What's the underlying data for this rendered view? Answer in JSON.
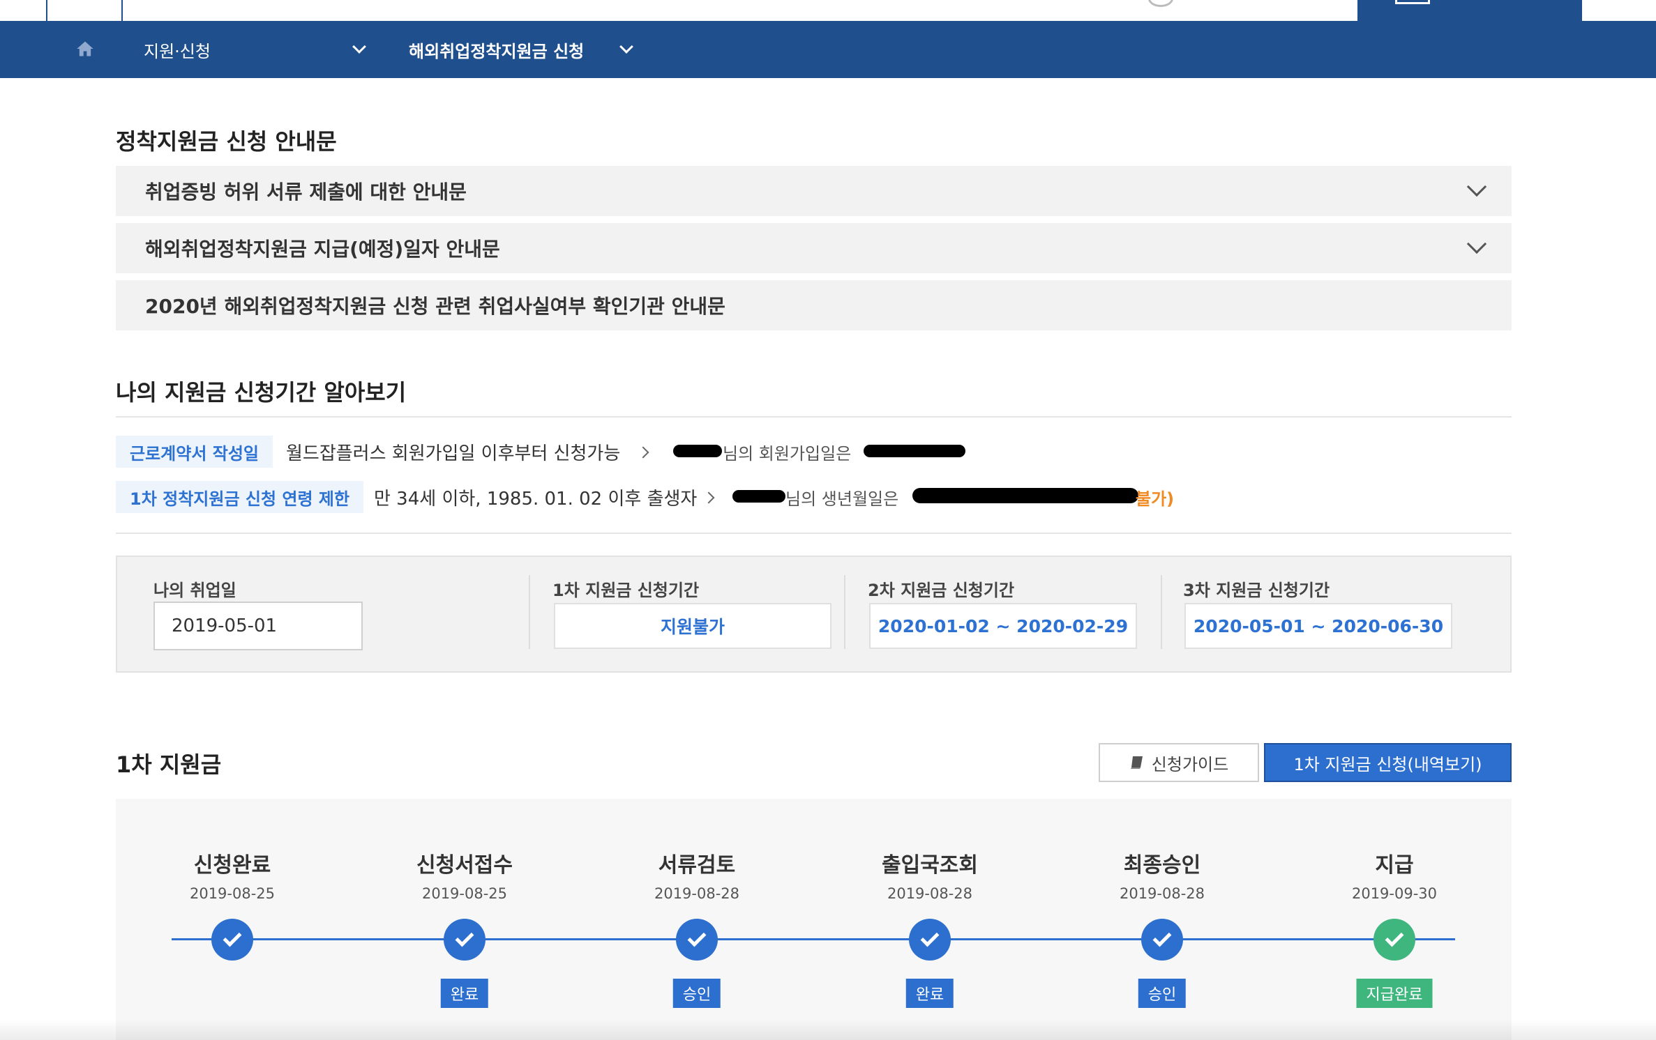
{
  "nav": {
    "item1": "지원·신청",
    "item2": "해외취업정착지원금 신청"
  },
  "notice": {
    "title": "정착지원금 신청 안내문",
    "items": [
      "취업증빙 허위 서류 제출에 대한 안내문",
      "해외취업정착지원금 지급(예정)일자 안내문",
      "2020년 해외취업정착지원금 신청 관련 취업사실여부 확인기관 안내문"
    ]
  },
  "period": {
    "title": "나의 지원금 신청기간 알아보기",
    "row1_tag": "근로계약서 작성일",
    "row1_text": "월드잡플러스 회원가입일 이후부터 신청가능",
    "row1_info": "님의 회원가입일은",
    "row2_tag": "1차 정착지원금 신청 연령 제한",
    "row2_text": "만 34세 이하, 1985. 01. 02 이후 출생자",
    "row2_info": "님의 생년월일은",
    "row2_tail": "불가)"
  },
  "info": {
    "label_my": "나의 취업일",
    "my_value": "2019-05-01",
    "label_1": "1차 지원금 신청기간",
    "value_1": "지원불가",
    "label_2": "2차 지원금 신청기간",
    "value_2": "2020-01-02 ~ 2020-02-29",
    "label_3": "3차 지원금 신청기간",
    "value_3": "2020-05-01 ~ 2020-06-30"
  },
  "first": {
    "title": "1차 지원금",
    "guide_button": "신청가이드",
    "history_button": "1차 지원금 신청(내역보기)"
  },
  "steps": [
    {
      "title": "신청완료",
      "date": "2019-08-25",
      "badge": ""
    },
    {
      "title": "신청서접수",
      "date": "2019-08-25",
      "badge": "완료"
    },
    {
      "title": "서류검토",
      "date": "2019-08-28",
      "badge": "승인"
    },
    {
      "title": "출입국조회",
      "date": "2019-08-28",
      "badge": "완료"
    },
    {
      "title": "최종승인",
      "date": "2019-08-28",
      "badge": "승인"
    },
    {
      "title": "지급",
      "date": "2019-09-30",
      "badge": "지급완료"
    }
  ],
  "colors": {
    "nav_bg": "#1f4f8c",
    "accent": "#2d6fcf",
    "success": "#3fb67e",
    "warning": "#f08a24"
  }
}
